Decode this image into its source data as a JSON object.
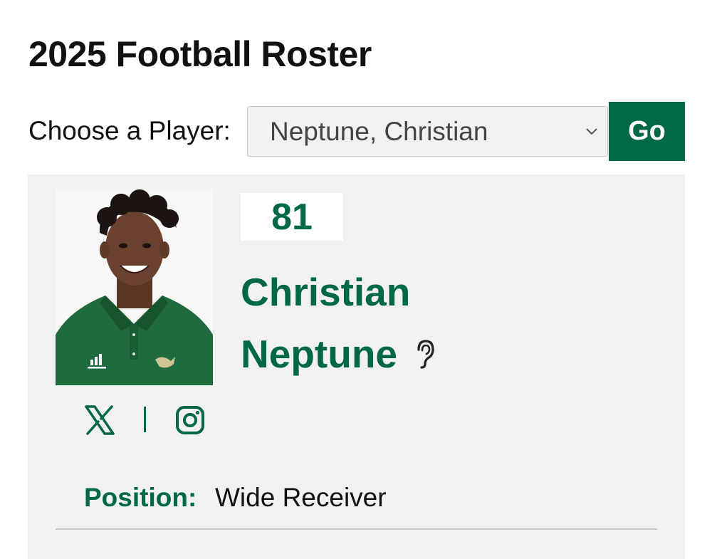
{
  "page": {
    "title": "2025 Football Roster"
  },
  "chooser": {
    "label": "Choose a Player:",
    "selected": "Neptune, Christian",
    "go_label": "Go"
  },
  "player": {
    "number": "81",
    "first_name": "Christian",
    "last_name": "Neptune",
    "position_label": "Position:",
    "position_value": "Wide Receiver",
    "social": [
      "x-icon",
      "instagram-icon"
    ],
    "pronunciation_icon": "ear-icon"
  },
  "colors": {
    "brand_green": "#006747",
    "card_bg": "#f1f1f1",
    "logo_gold": "#cfc493"
  }
}
